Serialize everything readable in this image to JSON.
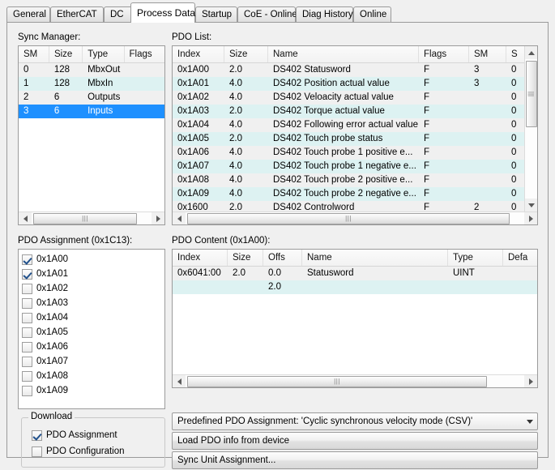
{
  "tabs": [
    {
      "label": "General",
      "active": false
    },
    {
      "label": "EtherCAT",
      "active": false
    },
    {
      "label": "DC",
      "active": false
    },
    {
      "label": "Process Data",
      "active": true
    },
    {
      "label": "Startup",
      "active": false
    },
    {
      "label": "CoE - Online",
      "active": false
    },
    {
      "label": "Diag History",
      "active": false
    },
    {
      "label": "Online",
      "active": false
    }
  ],
  "sync_manager": {
    "label": "Sync Manager:",
    "columns": [
      "SM",
      "Size",
      "Type",
      "Flags"
    ],
    "rows": [
      {
        "sm": "0",
        "size": "128",
        "type": "MbxOut",
        "flags": "",
        "state": "plain"
      },
      {
        "sm": "1",
        "size": "128",
        "type": "MbxIn",
        "flags": "",
        "state": "alt"
      },
      {
        "sm": "2",
        "size": "6",
        "type": "Outputs",
        "flags": "",
        "state": "plain"
      },
      {
        "sm": "3",
        "size": "6",
        "type": "Inputs",
        "flags": "",
        "state": "sel"
      }
    ]
  },
  "pdo_list": {
    "label": "PDO List:",
    "columns": [
      "Index",
      "Size",
      "Name",
      "Flags",
      "SM",
      "S"
    ],
    "rows": [
      {
        "index": "0x1A00",
        "size": "2.0",
        "name": "DS402 Statusword",
        "flags": "F",
        "sm": "3",
        "su": "0",
        "state": "plain"
      },
      {
        "index": "0x1A01",
        "size": "4.0",
        "name": "DS402 Position actual value",
        "flags": "F",
        "sm": "3",
        "su": "0",
        "state": "alt"
      },
      {
        "index": "0x1A02",
        "size": "4.0",
        "name": "DS402 Veloacity actual value",
        "flags": "F",
        "sm": "",
        "su": "0",
        "state": "plain"
      },
      {
        "index": "0x1A03",
        "size": "2.0",
        "name": "DS402 Torque actual value",
        "flags": "F",
        "sm": "",
        "su": "0",
        "state": "alt"
      },
      {
        "index": "0x1A04",
        "size": "4.0",
        "name": "DS402 Following error actual value",
        "flags": "F",
        "sm": "",
        "su": "0",
        "state": "plain"
      },
      {
        "index": "0x1A05",
        "size": "2.0",
        "name": "DS402 Touch probe status",
        "flags": "F",
        "sm": "",
        "su": "0",
        "state": "alt"
      },
      {
        "index": "0x1A06",
        "size": "4.0",
        "name": "DS402 Touch probe 1 positive e...",
        "flags": "F",
        "sm": "",
        "su": "0",
        "state": "plain"
      },
      {
        "index": "0x1A07",
        "size": "4.0",
        "name": "DS402 Touch probe 1 negative e...",
        "flags": "F",
        "sm": "",
        "su": "0",
        "state": "alt"
      },
      {
        "index": "0x1A08",
        "size": "4.0",
        "name": "DS402 Touch probe 2 positive e...",
        "flags": "F",
        "sm": "",
        "su": "0",
        "state": "plain"
      },
      {
        "index": "0x1A09",
        "size": "4.0",
        "name": "DS402 Touch probe 2 negative e...",
        "flags": "F",
        "sm": "",
        "su": "0",
        "state": "alt"
      },
      {
        "index": "0x1600",
        "size": "2.0",
        "name": "DS402 Controlword",
        "flags": "F",
        "sm": "2",
        "su": "0",
        "state": "plain"
      }
    ]
  },
  "pdo_assignment": {
    "label": "PDO Assignment (0x1C13):",
    "items": [
      {
        "label": "0x1A00",
        "checked": true
      },
      {
        "label": "0x1A01",
        "checked": true
      },
      {
        "label": "0x1A02",
        "checked": false
      },
      {
        "label": "0x1A03",
        "checked": false
      },
      {
        "label": "0x1A04",
        "checked": false
      },
      {
        "label": "0x1A05",
        "checked": false
      },
      {
        "label": "0x1A06",
        "checked": false
      },
      {
        "label": "0x1A07",
        "checked": false
      },
      {
        "label": "0x1A08",
        "checked": false
      },
      {
        "label": "0x1A09",
        "checked": false
      }
    ]
  },
  "pdo_content": {
    "label": "PDO Content (0x1A00):",
    "columns": [
      "Index",
      "Size",
      "Offs",
      "Name",
      "Type",
      "Defa"
    ],
    "rows": [
      {
        "index": "0x6041:00",
        "size": "2.0",
        "offs": "0.0",
        "name": "Statusword",
        "type": "UINT",
        "default": "",
        "state": "plain"
      },
      {
        "index": "",
        "size": "",
        "offs": "2.0",
        "name": "",
        "type": "",
        "default": "",
        "state": "alt"
      }
    ]
  },
  "download": {
    "title": "Download",
    "items": [
      {
        "label": "PDO Assignment",
        "checked": true
      },
      {
        "label": "PDO Configuration",
        "checked": false
      }
    ]
  },
  "bottom": {
    "predefined_combo": "Predefined PDO Assignment: 'Cyclic synchronous velocity mode (CSV)'",
    "load_pdo_button": "Load PDO info from device",
    "sync_unit_button": "Sync Unit Assignment..."
  }
}
